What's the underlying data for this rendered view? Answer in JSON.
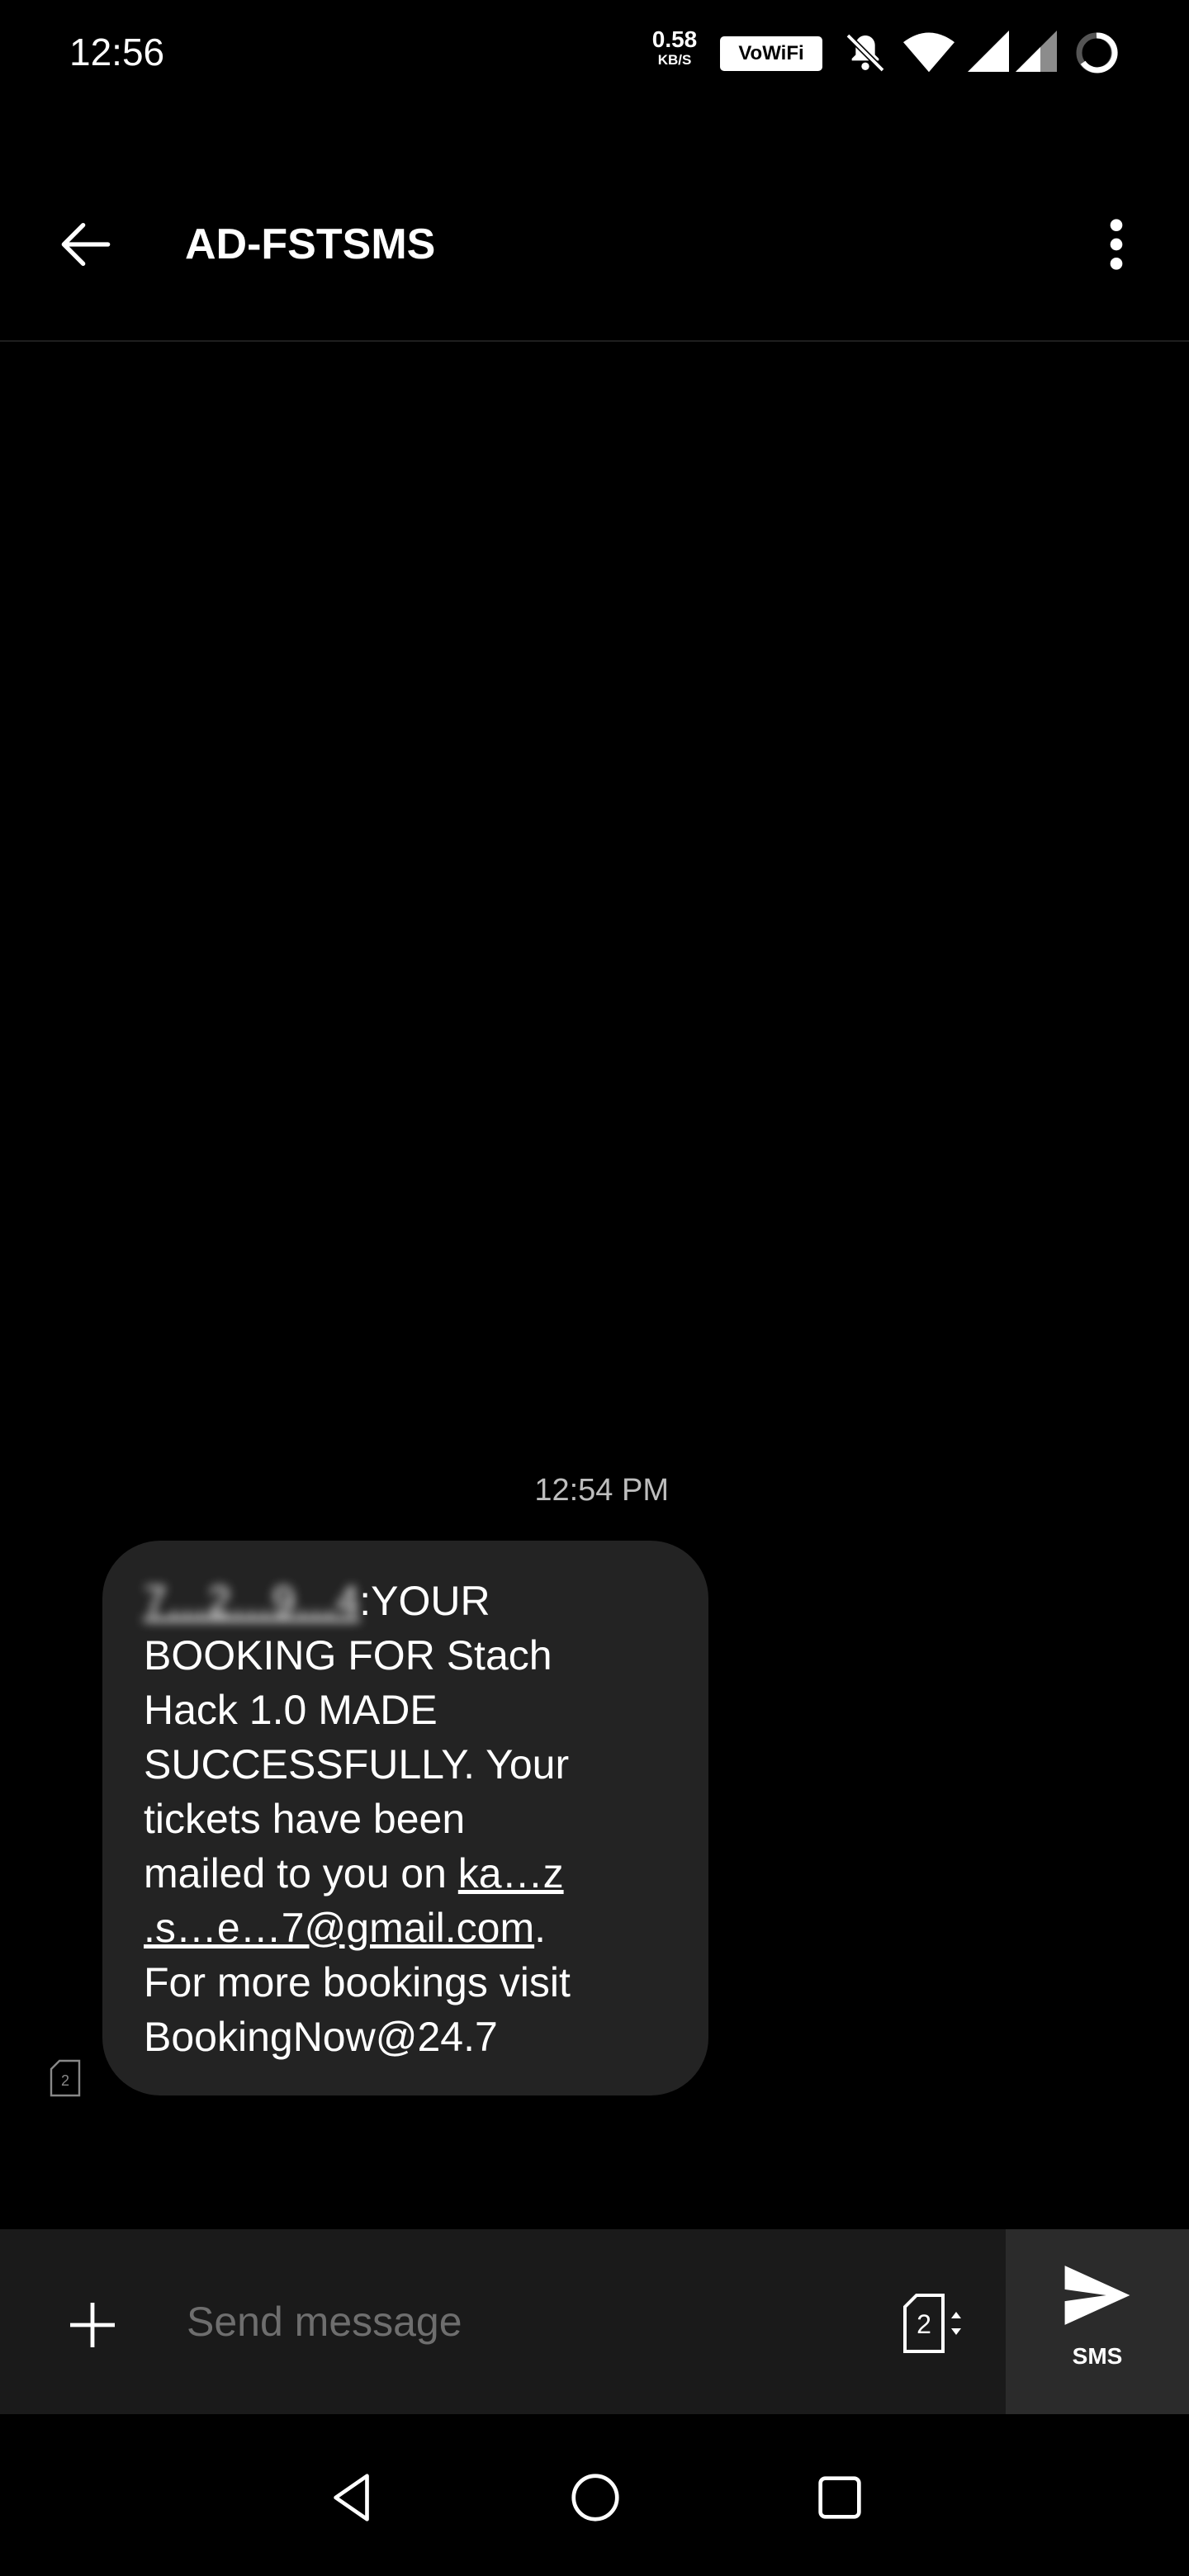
{
  "status_bar": {
    "time": "12:56",
    "speed_value": "0.58",
    "speed_unit": "KB/S",
    "vowifi": "VoWiFi"
  },
  "toolbar": {
    "title": "AD-FSTSMS"
  },
  "conversation": {
    "timestamp": "12:54 PM",
    "messages": [
      {
        "sender_number_redacted": "7…2…9…4",
        "text_part1": ":YOUR\nBOOKING FOR Stach\nHack 1.0 MADE\nSUCCESSFULLY. Your\ntickets have been\nmailed to you on ",
        "email_redacted": "ka…z\n.s…e…7@gmail.com",
        "text_part2": ".\nFor more bookings visit\nBookingNow@24.7",
        "sim_slot": "2"
      }
    ]
  },
  "compose": {
    "placeholder": "Send message",
    "sim_slot": "2",
    "send_label": "SMS"
  },
  "icons": {
    "back": "arrow-left-icon",
    "more": "more-vert-icon",
    "add": "plus-icon",
    "send": "send-icon",
    "sim": "sim-card-icon"
  }
}
